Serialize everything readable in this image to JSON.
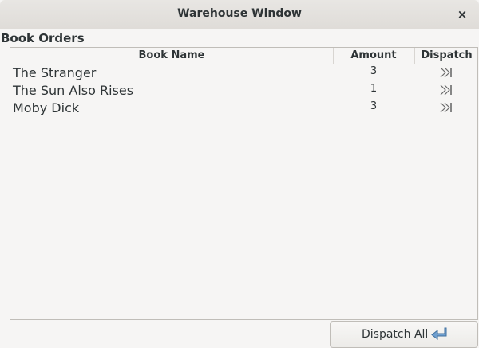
{
  "window": {
    "title": "Warehouse Window",
    "close_label": "×"
  },
  "section": {
    "title": "Book Orders"
  },
  "table": {
    "columns": [
      "Book Name",
      "Amount",
      "Dispatch"
    ],
    "rows": [
      {
        "book_name": "The Stranger",
        "amount": "3",
        "action_icon": "dispatch-icon"
      },
      {
        "book_name": "The Sun Also Rises",
        "amount": "1",
        "action_icon": "dispatch-icon"
      },
      {
        "book_name": "Moby Dick",
        "amount": "3",
        "action_icon": "dispatch-icon"
      }
    ]
  },
  "footer": {
    "dispatch_all_label": "Dispatch All",
    "dispatch_all_icon": "return-arrow-icon"
  },
  "colors": {
    "icon_blue": "#6f9fcf",
    "icon_gray": "#6a6a6a"
  }
}
